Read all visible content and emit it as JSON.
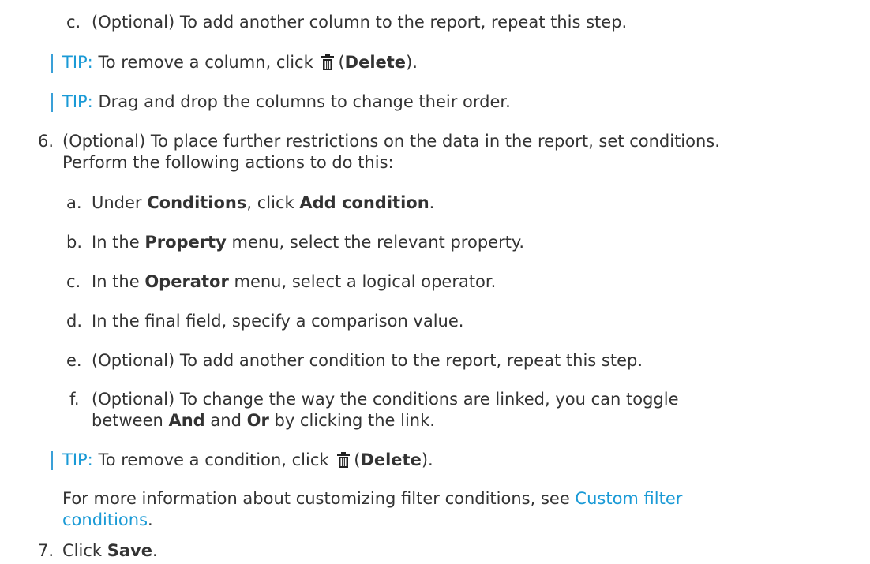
{
  "steps": {
    "c1": {
      "marker": "c.",
      "text": "(Optional) To add another column to the report, repeat this step."
    },
    "tip1": {
      "label": "TIP:",
      "pre": " To remove a column, click ",
      "paren_open": "(",
      "bold": "Delete",
      "paren_close": ")."
    },
    "tip2": {
      "label": "TIP:",
      "text": " Drag and drop the columns to change their order."
    },
    "step6": {
      "marker": "6.",
      "line1": "(Optional) To place further restrictions on the data in the report, set conditions.",
      "line2": "Perform the following actions to do this:"
    },
    "a": {
      "marker": "a.",
      "pre": "Under ",
      "bold1": "Conditions",
      "mid": ", click ",
      "bold2": "Add condition",
      "post": "."
    },
    "b": {
      "marker": "b.",
      "pre": "In the ",
      "bold": "Property",
      "post": " menu, select the relevant property."
    },
    "c2": {
      "marker": "c.",
      "pre": "In the ",
      "bold": "Operator",
      "post": " menu, select a logical operator."
    },
    "d": {
      "marker": "d.",
      "text": "In the final field, specify a comparison value."
    },
    "e": {
      "marker": "e.",
      "text": "(Optional) To add another condition to the report, repeat this step."
    },
    "f": {
      "marker": "f.",
      "line1": "(Optional) To change the way the conditions are linked, you can toggle",
      "pre": "between ",
      "bold1": "And",
      "mid": " and ",
      "bold2": "Or",
      "post": " by clicking the link."
    },
    "tip3": {
      "label": "TIP:",
      "pre": " To remove a condition, click ",
      "paren_open": "(",
      "bold": "Delete",
      "paren_close": ")."
    },
    "info": {
      "pre": "For more information about customizing filter conditions, see ",
      "link1": "Custom filter",
      "link2": "conditions",
      "post": "."
    },
    "step7": {
      "marker": "7.",
      "pre": "Click ",
      "bold": "Save",
      "post": "."
    }
  },
  "colors": {
    "link": "#1a9ad6",
    "tip_bar": "#3aa0d8",
    "text": "#333333"
  },
  "icons": {
    "delete": "trash-icon"
  }
}
